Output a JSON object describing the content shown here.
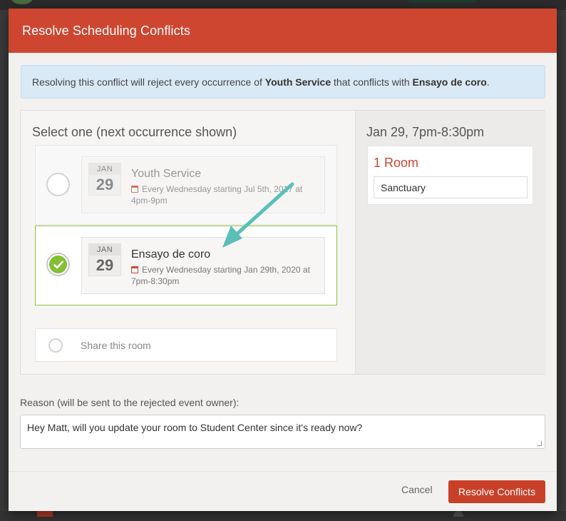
{
  "modal": {
    "title": "Resolve Scheduling Conflicts"
  },
  "alert": {
    "text_prefix": "Resolving this conflict will reject every occurrence of ",
    "event_a": "Youth Service",
    "text_middle": " that conflicts with ",
    "event_b": "Ensayo de coro",
    "text_suffix": "."
  },
  "selection": {
    "heading": "Select one (next occurrence shown)",
    "options": [
      {
        "month": "JAN",
        "day": "29",
        "name": "Youth Service",
        "recurrence": "Every Wednesday starting Jul 5th, 2017 at 4pm-9pm",
        "selected": false
      },
      {
        "month": "JAN",
        "day": "29",
        "name": "Ensayo de coro",
        "recurrence": "Every Wednesday starting Jan 29th, 2020 at 7pm-8:30pm",
        "selected": true
      }
    ],
    "share_label": "Share this room"
  },
  "conflict": {
    "date": "Jan 29, 7pm-8:30pm",
    "room_count": "1 Room",
    "rooms": [
      "Sanctuary"
    ]
  },
  "reason": {
    "label": "Reason (will be sent to the rejected event owner):",
    "value": "Hey Matt, will you update your room to Student Center since it's ready now?"
  },
  "footer": {
    "cancel_label": "Cancel",
    "resolve_label": "Resolve Conflicts"
  },
  "colors": {
    "header": "#cf4630",
    "selected": "#83bf34",
    "arrow": "#5bbfb9",
    "alert_bg": "#d9e9f6"
  },
  "icons": [
    "calendar-repeat-icon",
    "checkmark-icon",
    "annotation-arrow"
  ]
}
